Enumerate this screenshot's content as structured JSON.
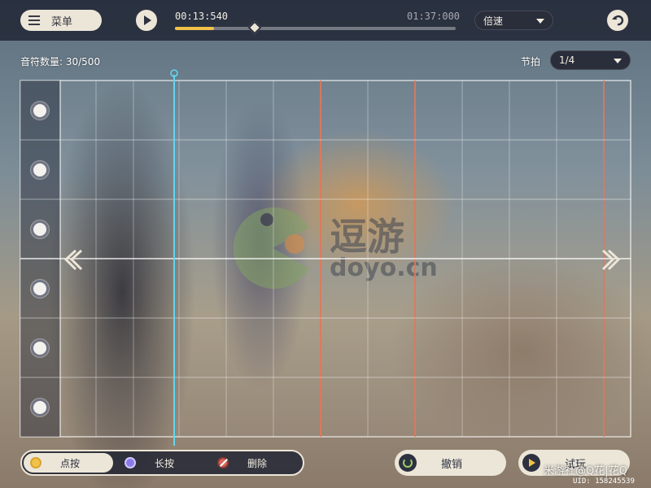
{
  "colors": {
    "accent_yellow": "#f0c24a",
    "playhead_cyan": "#5fd6f0",
    "measure_orange": "#e0785a",
    "panel_dark": "#1e2332",
    "button_cream": "#ece6d8"
  },
  "topbar": {
    "menu_label": "菜单",
    "menu_icon": "list-icon",
    "play_icon": "play-icon",
    "current_time": "00:13:540",
    "total_time": "01:37:000",
    "progress_fraction": 0.14,
    "speed_label": "倍速",
    "back_icon": "return-arrow-icon"
  },
  "editor": {
    "note_count": "音符数量: 30/500",
    "beat_label": "节拍",
    "beat_value": "1/4",
    "lanes": 6,
    "playhead_position": 0.2,
    "left_arrow_icon": "chevron-left-icon",
    "right_arrow_icon": "chevron-right-icon"
  },
  "watermark": {
    "brand": "逗游",
    "domain": "doyo.cn"
  },
  "bottom": {
    "modes": [
      {
        "label": "点按",
        "icon": "tap-dot-icon",
        "active": true
      },
      {
        "label": "长按",
        "icon": "hold-dot-icon",
        "active": false
      },
      {
        "label": "删除",
        "icon": "delete-icon",
        "active": false
      }
    ],
    "undo_label": "撤销",
    "try_label": "试玩"
  },
  "credit": {
    "author": "米游社@Q花|花Q",
    "uid": "UID: 158245539"
  }
}
